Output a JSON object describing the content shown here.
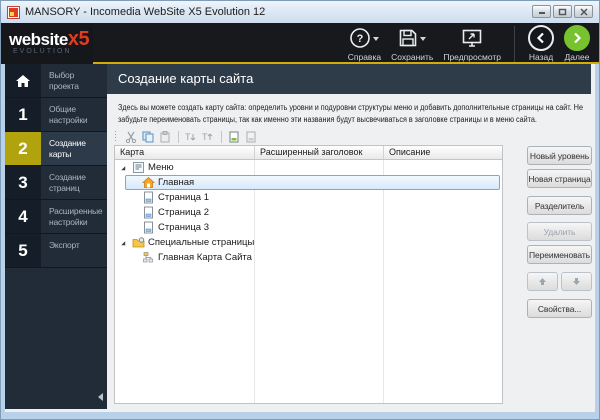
{
  "window": {
    "title": "MANSORY - Incomedia WebSite X5 Evolution 12"
  },
  "logo": {
    "brand": "website",
    "x5": "x5",
    "subtitle": "EVOLUTION"
  },
  "header_toolbar": {
    "help": "Справка",
    "save": "Сохранить",
    "preview": "Предпросмотр",
    "back": "Назад",
    "next": "Далее"
  },
  "sidebar": {
    "items": [
      {
        "num": "",
        "label": "Выбор проекта"
      },
      {
        "num": "1",
        "label": "Общие настройки"
      },
      {
        "num": "2",
        "label": "Создание карты"
      },
      {
        "num": "3",
        "label": "Создание страниц"
      },
      {
        "num": "4",
        "label": "Расширенные настройки"
      },
      {
        "num": "5",
        "label": "Экспорт"
      }
    ]
  },
  "main": {
    "title": "Создание карты сайта",
    "description_lines": [
      "Здесь вы можете создать карту сайта: определить уровни и подуровни структуры меню и добавить дополнительные страницы на сайт. Не",
      "забудьте переименовать страницы, так как именно эти названия будут высвечиваться в заголовке страницы и в меню сайта."
    ],
    "table": {
      "columns": [
        "Карта",
        "Расширенный заголовок",
        "Описание"
      ],
      "rows": [
        {
          "label": "Меню"
        },
        {
          "label": "Главная"
        },
        {
          "label": "Страница 1"
        },
        {
          "label": "Страница 2"
        },
        {
          "label": "Страница 3"
        },
        {
          "label": "Специальные страницы"
        },
        {
          "label": "Главная Карта Сайта"
        }
      ]
    },
    "buttons": {
      "new_level": "Новый уровень",
      "new_page": "Новая страница",
      "separator": "Разделитель",
      "delete": "Удалить",
      "rename": "Переименовать",
      "properties": "Свойства..."
    }
  },
  "colors": {
    "accent_yellow": "#d2ad0a",
    "next_green": "#77c22e",
    "brand_red": "#e23c20"
  }
}
